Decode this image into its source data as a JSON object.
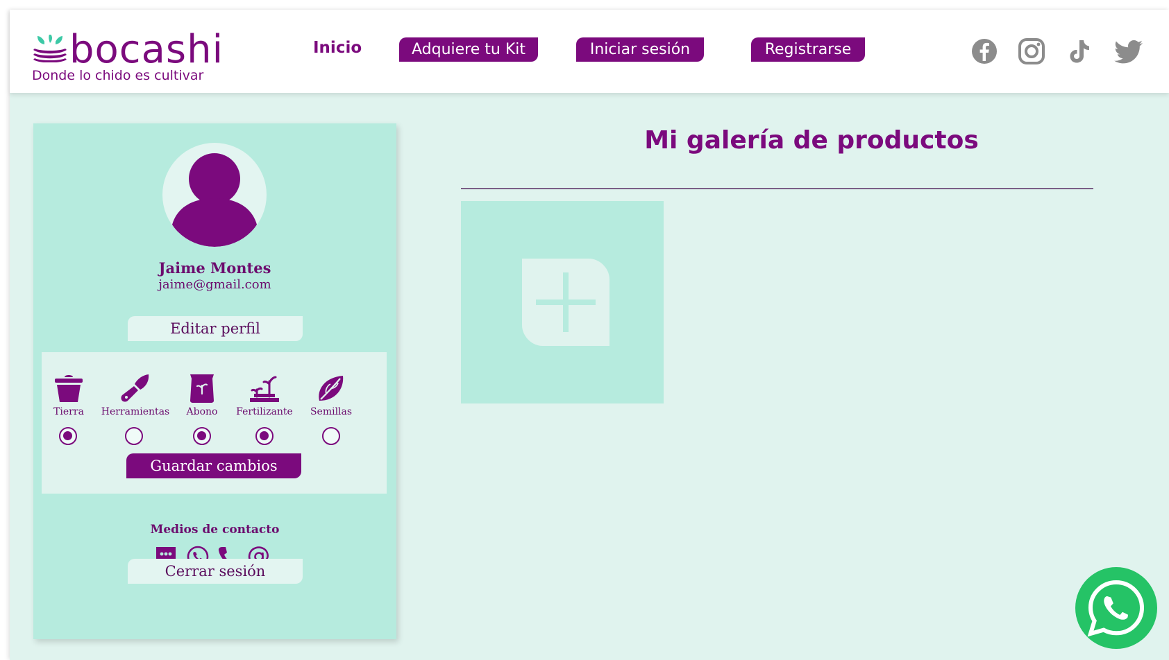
{
  "brand": {
    "name": "bocashi",
    "tagline": "Donde lo chido es cultivar",
    "color": "#7b0a7d",
    "accent": "#3dc9a6"
  },
  "nav": {
    "home": "Inicio",
    "kit": "Adquiere tu Kit",
    "login": "Iniciar sesión",
    "register": "Registrarse"
  },
  "social": [
    "facebook-icon",
    "instagram-icon",
    "tiktok-icon",
    "twitter-icon"
  ],
  "profile": {
    "name": "Jaime Montes",
    "email": "jaime@gmail.com",
    "edit_label": "Editar perfil",
    "categories": [
      {
        "label": "Tierra",
        "icon": "pot-icon",
        "selected": true
      },
      {
        "label": "Herramientas",
        "icon": "trowel-icon",
        "selected": false
      },
      {
        "label": "Abono",
        "icon": "compost-bag-icon",
        "selected": true
      },
      {
        "label": "Fertilizante",
        "icon": "sprouts-icon",
        "selected": true
      },
      {
        "label": "Semillas",
        "icon": "seed-icon",
        "selected": false
      }
    ],
    "save_label": "Guardar cambios",
    "contact_title": "Medios de contacto",
    "contact_icons": [
      "chat-icon",
      "whatsapp-icon",
      "phone-icon",
      "at-sign-icon"
    ],
    "logout_label": "Cerrar sesión"
  },
  "gallery": {
    "title": "Mi galería de productos",
    "add_icon": "add-product-icon"
  },
  "colors": {
    "page_bg": "#e0f3ee",
    "card_bg": "#b6ebde",
    "whatsapp": "#25c366"
  }
}
